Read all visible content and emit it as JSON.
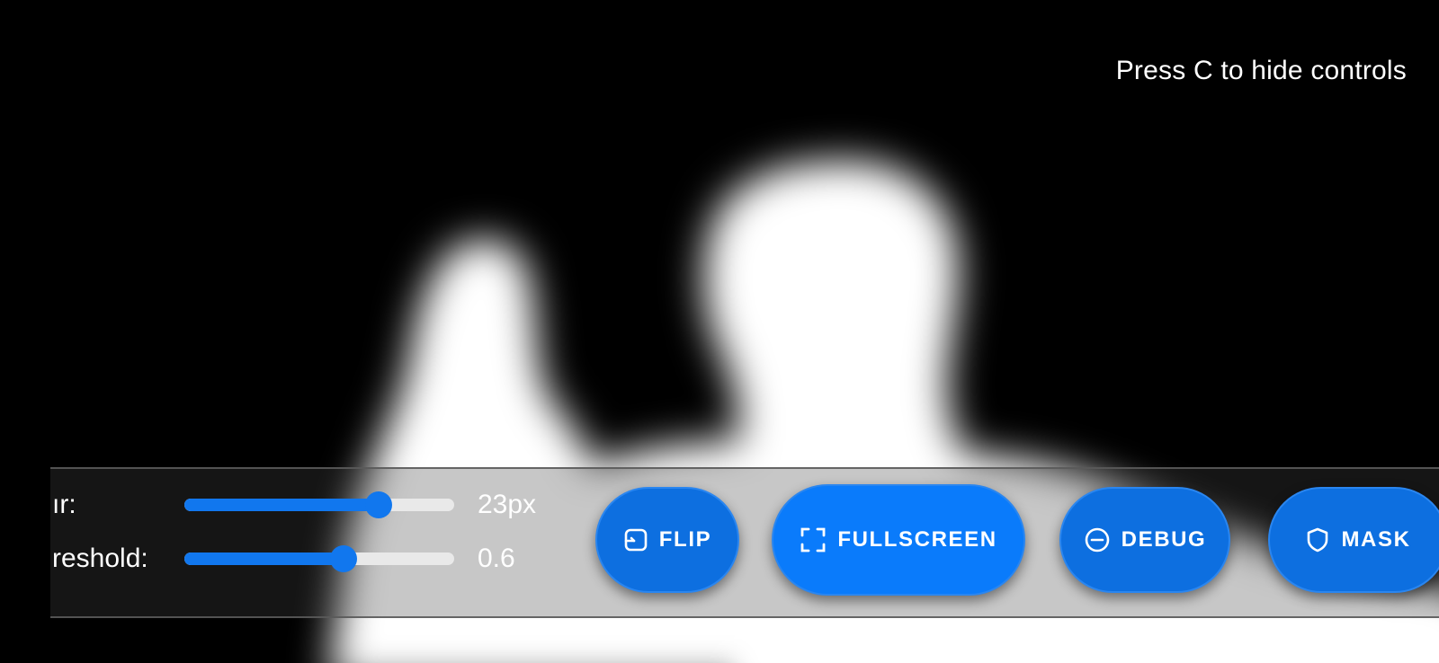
{
  "hint": "Press C to hide controls",
  "sliders": {
    "blur": {
      "label": "ır:",
      "value_text": "23px",
      "fraction": 0.72
    },
    "threshold": {
      "label": "reshold:",
      "value_text": "0.6",
      "fraction": 0.59
    }
  },
  "buttons": {
    "flip": {
      "label": "FLIP",
      "icon": "flip-icon"
    },
    "fullscreen": {
      "label": "FULLSCREEN",
      "icon": "fullscreen-icon"
    },
    "debug": {
      "label": "DEBUG",
      "icon": "minus-circle-icon"
    },
    "mask": {
      "label": "MASK",
      "icon": "shield-icon"
    }
  },
  "colors": {
    "accent": "#0a7bfb",
    "button_bg": "#0d6fe0",
    "track": "#e9e9e9"
  }
}
